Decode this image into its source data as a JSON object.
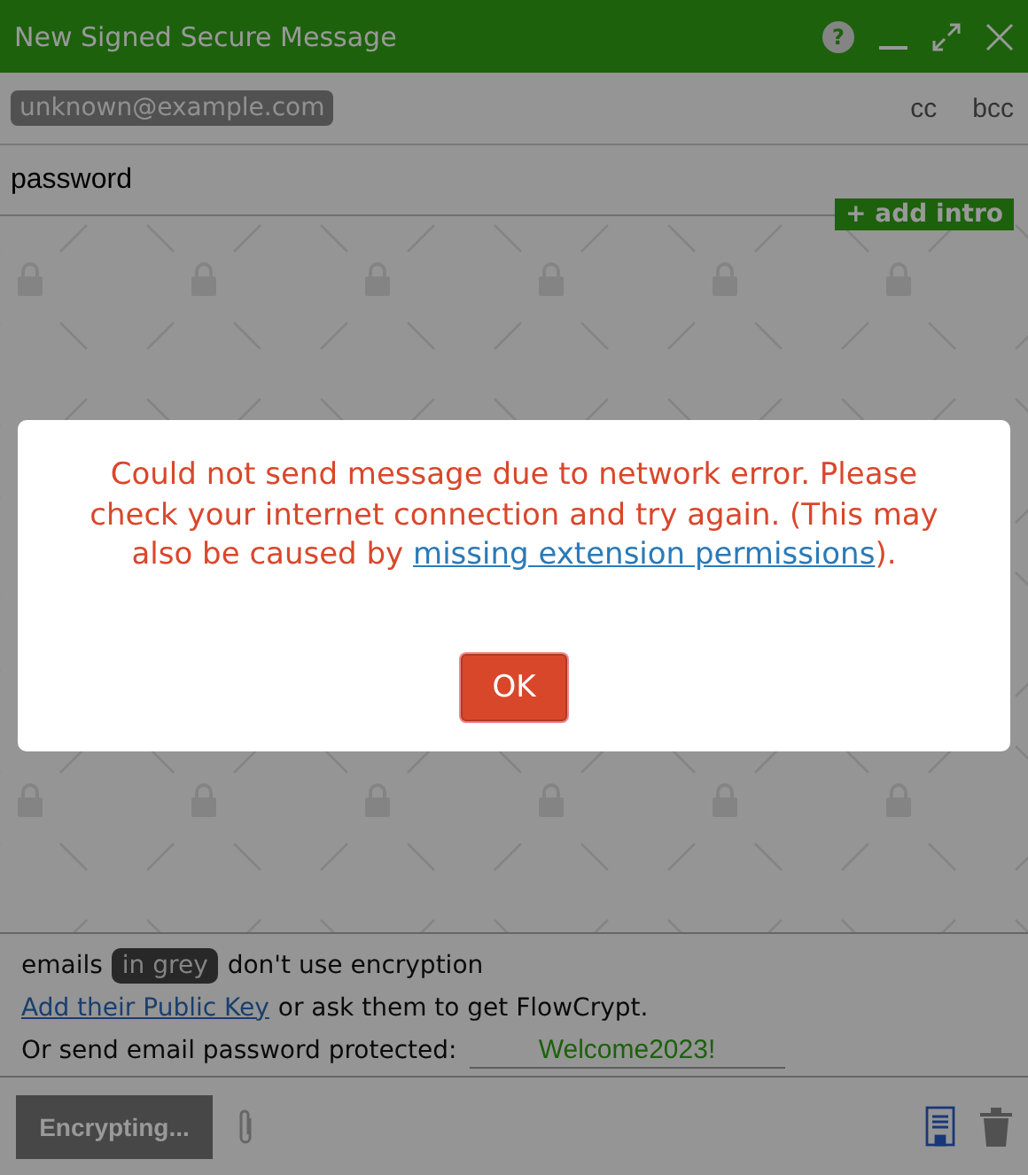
{
  "window": {
    "title": "New Signed Secure Message",
    "controls": [
      {
        "kind": "help",
        "label": "?"
      },
      {
        "kind": "minimize"
      },
      {
        "kind": "maximize"
      },
      {
        "kind": "close"
      }
    ]
  },
  "recipients": [
    {
      "email": "unknown@example.com"
    }
  ],
  "recipient_options": [
    "cc",
    "bcc"
  ],
  "subject": {
    "value": "password"
  },
  "add_intro": "+ add intro",
  "notice": {
    "prefix": "emails",
    "badge": "in grey",
    "suffix": "don't use encryption",
    "link": "Add their Public Key",
    "link_rest": "or ask them to get FlowCrypt.",
    "password_label": "Or send email password protected:",
    "password_value": "Welcome2023!"
  },
  "footer": {
    "send_button": {
      "label": "Encrypting...",
      "disabled": true
    }
  },
  "dialog": {
    "message_before": "Could not send message due to network error. Please check your internet connection and try again. (This may also be caused by ",
    "link": "missing extension permissions",
    "message_after": ").",
    "button": "OK"
  }
}
